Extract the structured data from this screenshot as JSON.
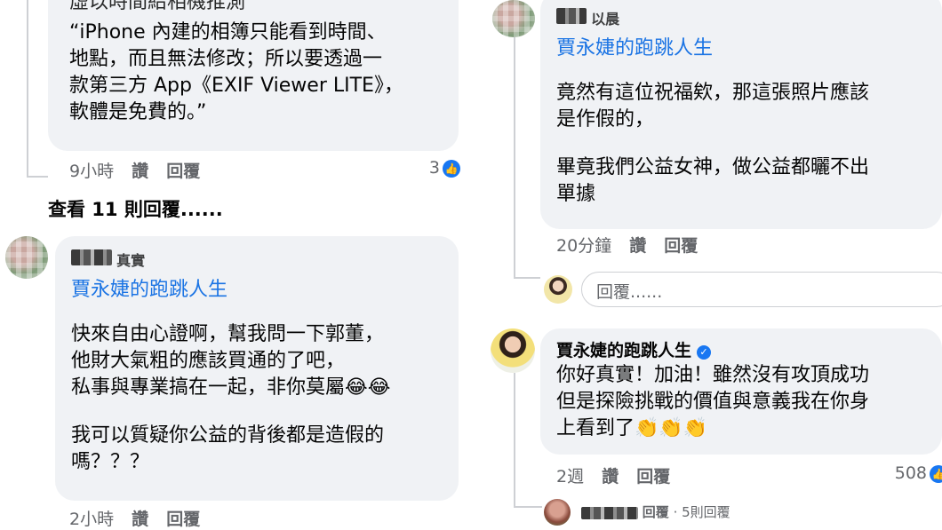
{
  "left": {
    "top_comment": {
      "partial_line": "虛以時間給相機推測",
      "lines": [
        "“iPhone 內建的相簿只能看到時間、",
        "地點，而且無法修改；所以要透過一",
        "款第三方 App《EXIF Viewer LITE》，",
        "軟體是免費的。”"
      ],
      "time": "9小時",
      "like": "讚",
      "reply": "回覆",
      "like_count": "3"
    },
    "view_more": "查看 11 則回覆......",
    "comment2": {
      "name": "真實",
      "tag": "賈永婕的跑跳人生",
      "paragraph1": [
        "快來自由心證啊，幫我問一下郭董，",
        "他財大氣粗的應該買通的了吧，",
        "私事與專業搞在一起，非你莫屬😂😂"
      ],
      "paragraph2": [
        "我可以質疑你公益的背後都是造假的",
        "嗎？？？"
      ],
      "time": "2小時",
      "like": "讚",
      "reply": "回覆"
    }
  },
  "right": {
    "comment1": {
      "name": "以晨",
      "tag": "賈永婕的跑跳人生",
      "paragraph1": [
        "竟然有這位祝福欸，那這張照片應該",
        "是作假的，"
      ],
      "paragraph2": [
        "畢竟我們公益女神，做公益都曬不出",
        "單據"
      ],
      "time": "20分鐘",
      "like": "讚",
      "reply": "回覆"
    },
    "reply_input": {
      "placeholder": "回覆......"
    },
    "comment2": {
      "name": "賈永婕的跑跳人生",
      "lines": [
        "你好真實！加油！雖然沒有攻頂成功",
        "但是探險挑戰的價值與意義我在你身",
        "上看到了👏👏👏"
      ],
      "time": "2週",
      "like": "讚",
      "reply": "回覆",
      "like_count": "508"
    },
    "replies_summary": {
      "text": "回覆",
      "count": "· 5則回覆"
    }
  },
  "colors": {
    "link": "#1b74e4",
    "bubble": "#f0f2f5",
    "meta": "#65676b",
    "like": "#1877f2"
  }
}
